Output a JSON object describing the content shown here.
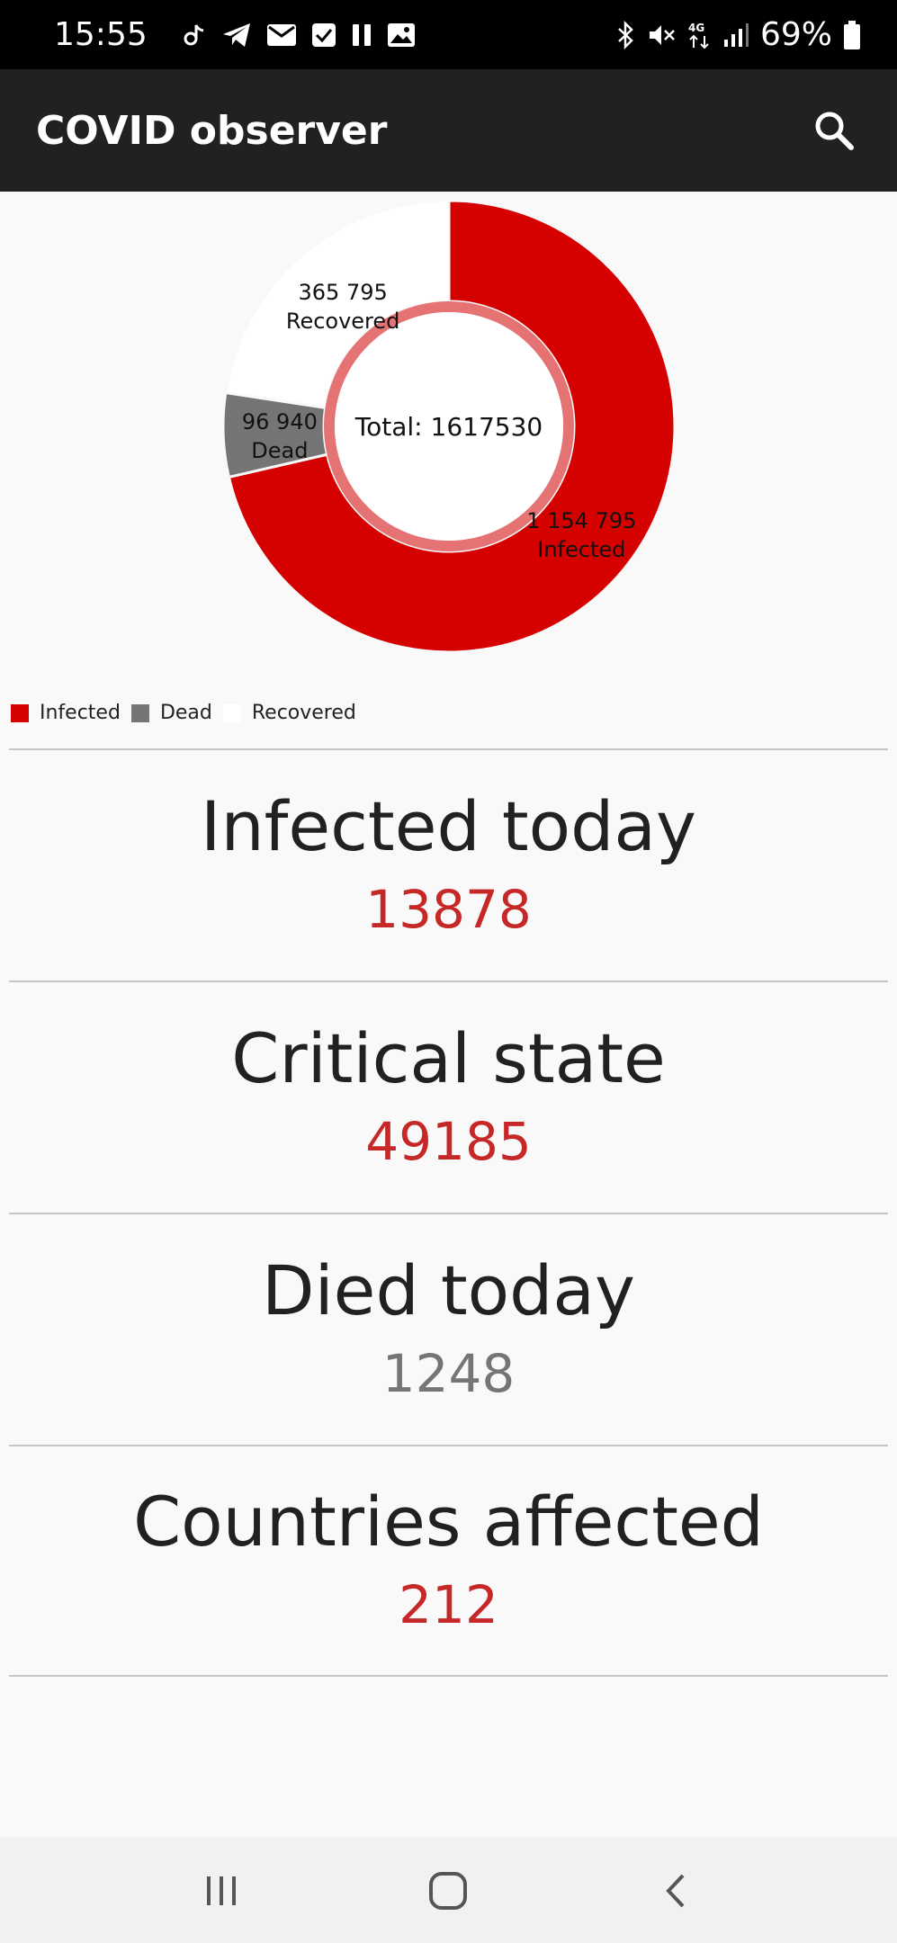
{
  "status_bar": {
    "time": "15:55",
    "left_icons": [
      "tiktok-icon",
      "telegram-icon",
      "mail-icon",
      "check-icon",
      "pause-icon",
      "image-icon"
    ],
    "right_icons": [
      "bluetooth-icon",
      "mute-icon",
      "4g-icon",
      "signal-icon"
    ],
    "battery": "69%"
  },
  "app_bar": {
    "title": "COVID observer",
    "search_icon": "search-icon"
  },
  "chart_data": {
    "type": "pie",
    "center_text": "Total: 1617530",
    "slices": [
      {
        "name": "Infected",
        "value": 1154795,
        "value_label": "1 154 795",
        "color": "#d50000"
      },
      {
        "name": "Dead",
        "value": 96940,
        "value_label": "96 940",
        "color": "#757575"
      },
      {
        "name": "Recovered",
        "value": 365795,
        "value_label": "365 795",
        "color": "#ffffff"
      }
    ],
    "legend": [
      "Infected",
      "Dead",
      "Recovered"
    ],
    "legend_placement": "bottom-left"
  },
  "stats": [
    {
      "label": "Infected today",
      "value": "13878",
      "color": "#c62828"
    },
    {
      "label": "Critical state",
      "value": "49185",
      "color": "#c62828"
    },
    {
      "label": "Died today",
      "value": "1248",
      "color": "#757575"
    },
    {
      "label": "Countries affected",
      "value": "212",
      "color": "#c62828"
    }
  ],
  "nav_bar": {
    "buttons": [
      "recents-icon",
      "home-icon",
      "back-icon"
    ]
  }
}
